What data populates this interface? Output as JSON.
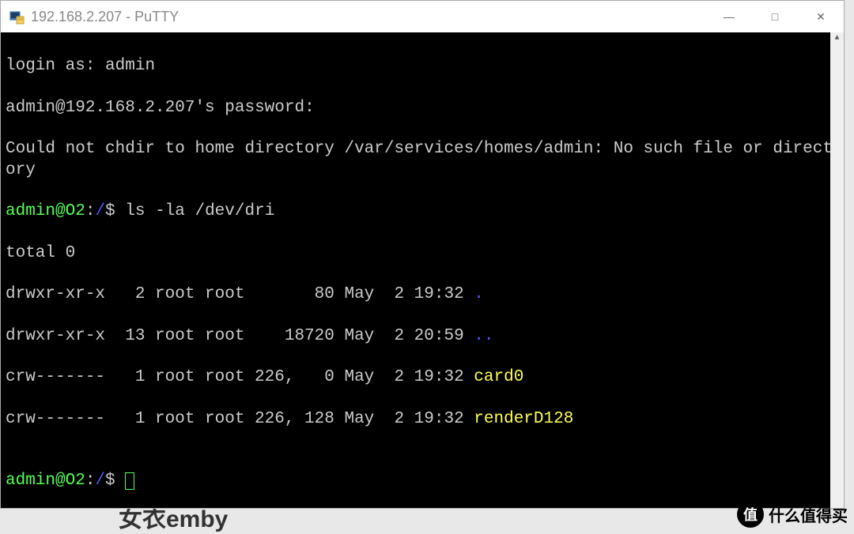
{
  "window": {
    "title": "192.168.2.207 - PuTTY",
    "controls": {
      "minimize": "—",
      "maximize": "□",
      "close": "✕"
    }
  },
  "terminal": {
    "login_prompt": "login as: ",
    "login_user": "admin",
    "password_prompt_user": "admin@192.168.2.207",
    "password_prompt_suffix": "'s password:",
    "error_line": "Could not chdir to home directory /var/services/homes/admin: No such file or directory",
    "prompt1_user": "admin@O2",
    "prompt1_sep": ":",
    "prompt1_path": "/",
    "prompt1_dollar": "$ ",
    "command1": "ls -la /dev/dri",
    "output": {
      "total": "total 0",
      "rows": [
        {
          "perm": "drwxr-xr-x",
          "links": "  2",
          "user": "root",
          "group": "root",
          "size": "     80",
          "date": "May  2 19:32",
          "name": ".",
          "color": "blue"
        },
        {
          "perm": "drwxr-xr-x",
          "links": " 13",
          "user": "root",
          "group": "root",
          "size": "  18720",
          "date": "May  2 20:59",
          "name": "..",
          "color": "blue"
        },
        {
          "perm": "crw-------",
          "links": "  1",
          "user": "root",
          "group": "root",
          "size": "226,   0",
          "date": "May  2 19:32",
          "name": "card0",
          "color": "yellow"
        },
        {
          "perm": "crw-------",
          "links": "  1",
          "user": "root",
          "group": "root",
          "size": "226, 128",
          "date": "May  2 19:32",
          "name": "renderD128",
          "color": "yellow"
        }
      ]
    },
    "prompt2_user": "admin@O2",
    "prompt2_sep": ":",
    "prompt2_path": "/",
    "prompt2_dollar": "$ "
  },
  "watermark": {
    "icon_text": "值",
    "text": "什么值得买"
  },
  "bg": {
    "partial_text": "女衣emby"
  }
}
